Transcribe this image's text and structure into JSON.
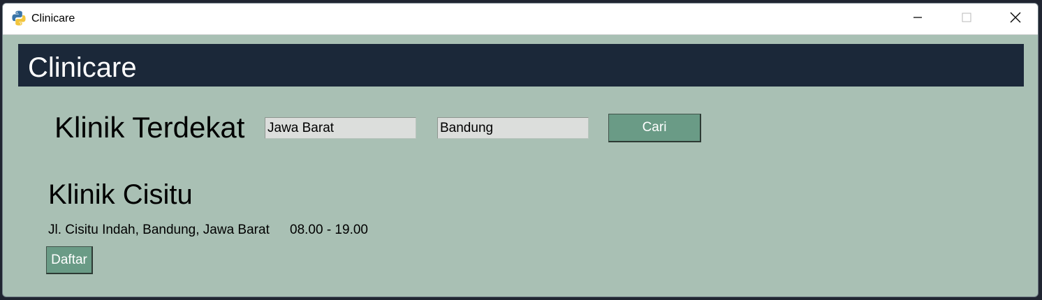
{
  "window": {
    "title": "Clinicare",
    "controls": {
      "minimize": "minimize-icon",
      "maximize": "maximize-icon",
      "close": "close-icon"
    }
  },
  "header": {
    "title": "Clinicare",
    "background": "#1b2839"
  },
  "search": {
    "section_title": "Klinik Terdekat",
    "province_value": "Jawa Barat",
    "city_value": "Bandung",
    "button_label": "Cari",
    "button_color": "#6a9b86"
  },
  "results": [
    {
      "name": "Klinik Cisitu",
      "address": "Jl. Cisitu Indah, Bandung, Jawa Barat",
      "hours": "08.00 - 19.00",
      "button_label": "Daftar"
    }
  ],
  "colors": {
    "content_background": "#a9c0b4",
    "button": "#6a9b86"
  }
}
